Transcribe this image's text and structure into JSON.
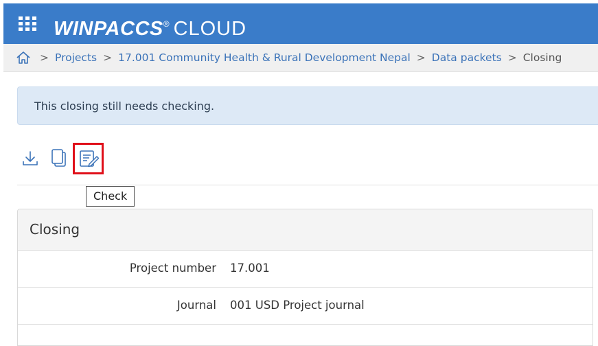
{
  "header": {
    "app_name": "WINPACCS",
    "registered_mark": "®",
    "app_suffix": "CLOUD",
    "brand_color": "#3a7cc9"
  },
  "breadcrumb": {
    "home_icon": "home-icon",
    "separator": ">",
    "items": [
      {
        "label": "Projects"
      },
      {
        "label": "17.001 Community Health & Rural Development Nepal"
      },
      {
        "label": "Data packets"
      },
      {
        "label": "Closing"
      }
    ]
  },
  "alert": {
    "message": "This closing still needs checking."
  },
  "toolbar": {
    "icons": [
      "download-icon",
      "copy-icon",
      "check-edit-icon"
    ],
    "tooltip": "Check",
    "highlight_color": "#e0101a"
  },
  "panel": {
    "title": "Closing",
    "rows": [
      {
        "label": "Project number",
        "value": "17.001"
      },
      {
        "label": "Journal",
        "value": "001 USD Project journal"
      }
    ]
  }
}
